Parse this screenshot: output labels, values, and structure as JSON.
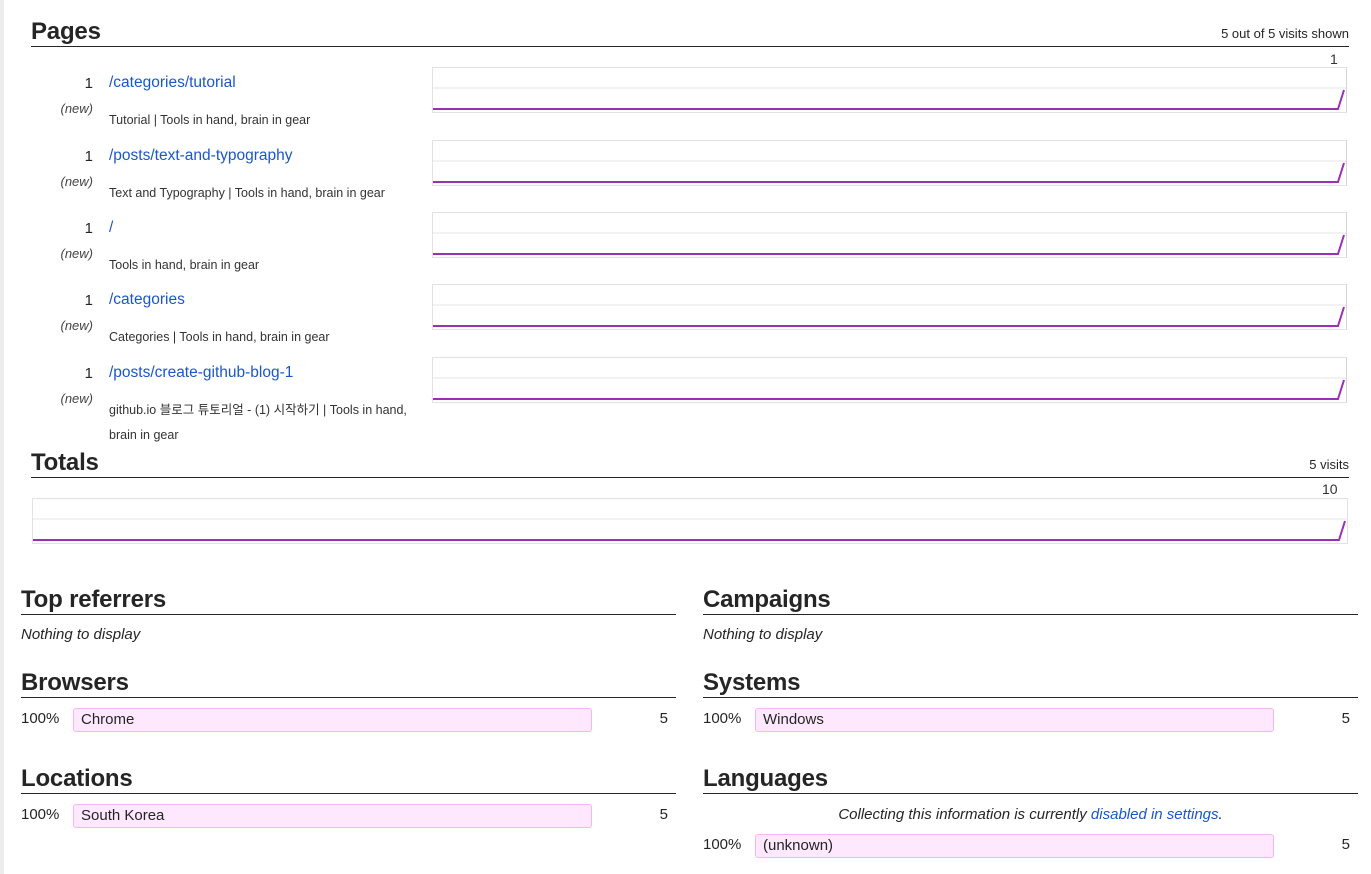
{
  "pages": {
    "heading": "Pages",
    "summary": "5 out of 5 visits shown",
    "max_label": "1",
    "rows": [
      {
        "count": "1",
        "badge": "(new)",
        "path": "/categories/tutorial",
        "title": "Tutorial | Tools in hand, brain in gear"
      },
      {
        "count": "1",
        "badge": "(new)",
        "path": "/posts/text-and-typography",
        "title": "Text and Typography | Tools in hand, brain in gear"
      },
      {
        "count": "1",
        "badge": "(new)",
        "path": "/",
        "title": "Tools in hand, brain in gear"
      },
      {
        "count": "1",
        "badge": "(new)",
        "path": "/categories",
        "title": "Categories | Tools in hand, brain in gear"
      },
      {
        "count": "1",
        "badge": "(new)",
        "path": "/posts/create-github-blog-1",
        "title": "github.io 블로그 튜토리얼 - (1) 시작하기 | Tools in hand, brain in gear"
      }
    ]
  },
  "totals": {
    "heading": "Totals",
    "summary": "5 visits",
    "max_label": "10"
  },
  "top_referrers": {
    "heading": "Top referrers",
    "empty": "Nothing to display"
  },
  "campaigns": {
    "heading": "Campaigns",
    "empty": "Nothing to display"
  },
  "browsers": {
    "heading": "Browsers",
    "items": [
      {
        "percent": "100%",
        "name": "Chrome",
        "count": "5",
        "share": 1.0
      }
    ]
  },
  "systems": {
    "heading": "Systems",
    "items": [
      {
        "percent": "100%",
        "name": "Windows",
        "count": "5",
        "share": 1.0
      }
    ]
  },
  "locations": {
    "heading": "Locations",
    "items": [
      {
        "percent": "100%",
        "name": "South Korea",
        "count": "5",
        "share": 1.0
      }
    ]
  },
  "languages": {
    "heading": "Languages",
    "notice_text": "Collecting this information is currently ",
    "notice_link": "disabled in settings",
    "notice_end": ".",
    "items": [
      {
        "percent": "100%",
        "name": "(unknown)",
        "count": "5",
        "share": 1.0
      }
    ]
  },
  "colors": {
    "spark_line": "#9b30b8",
    "bar_fill": "#fde8fd",
    "bar_border": "#f4b6f4",
    "link": "#1a57c9"
  }
}
